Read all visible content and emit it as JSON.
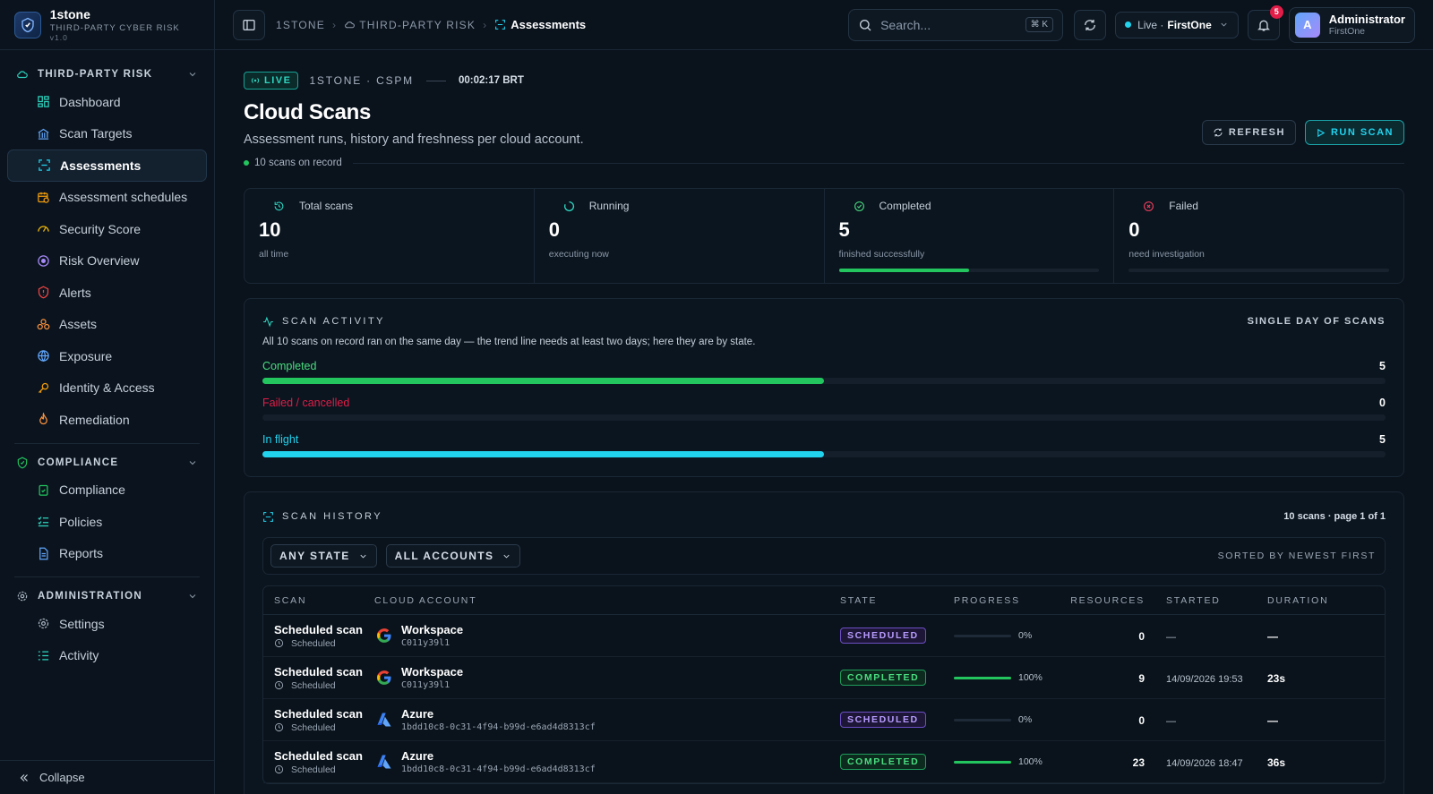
{
  "brand": {
    "name": "1stone",
    "subtitle": "THIRD-PARTY CYBER RISK",
    "version": "v1.0"
  },
  "sidebar": {
    "sections": [
      {
        "title": "THIRD-PARTY RISK",
        "items": [
          "Dashboard",
          "Scan Targets",
          "Assessments",
          "Assessment schedules",
          "Security Score",
          "Risk Overview",
          "Alerts",
          "Assets",
          "Exposure",
          "Identity & Access",
          "Remediation"
        ]
      },
      {
        "title": "COMPLIANCE",
        "items": [
          "Compliance",
          "Policies",
          "Reports"
        ]
      },
      {
        "title": "ADMINISTRATION",
        "items": [
          "Settings",
          "Activity"
        ]
      }
    ],
    "active": "Assessments",
    "collapse_label": "Collapse"
  },
  "topbar": {
    "breadcrumbs": [
      "1STONE",
      "THIRD-PARTY RISK",
      "Assessments"
    ],
    "search_placeholder": "Search...",
    "search_shortcut": "⌘ K",
    "env_status": "Live ·",
    "env_name": "FirstOne",
    "notifications": "5",
    "user": {
      "initial": "A",
      "name": "Administrator",
      "org": "FirstOne"
    }
  },
  "page": {
    "live_label": "LIVE",
    "meta": "1STONE · CSPM",
    "time": "00:02:17 BRT",
    "title": "Cloud Scans",
    "subtitle": "Assessment runs, history and freshness per cloud account.",
    "records": "10 scans on record",
    "refresh_label": "REFRESH",
    "run_label": "RUN SCAN"
  },
  "stats": [
    {
      "label": "Total scans",
      "value": "10",
      "sub": "all time",
      "bar": null,
      "color": "#2dd4bf"
    },
    {
      "label": "Running",
      "value": "0",
      "sub": "executing now",
      "bar": null,
      "color": "#2dd4bf"
    },
    {
      "label": "Completed",
      "value": "5",
      "sub": "finished successfully",
      "bar": 0.5,
      "color": "#4ade80"
    },
    {
      "label": "Failed",
      "value": "0",
      "sub": "need investigation",
      "bar": 0,
      "color": "#f43f5e"
    }
  ],
  "activity": {
    "title": "SCAN ACTIVITY",
    "right": "SINGLE DAY OF SCANS",
    "description": "All 10 scans on record ran on the same day — the trend line needs at least two days; here they are by state.",
    "total": 10,
    "rows": [
      {
        "label": "Completed",
        "value": 5,
        "color": "#4ade80",
        "bar": "#22c55e"
      },
      {
        "label": "Failed / cancelled",
        "value": 0,
        "color": "#e11d48",
        "bar": "#e11d48"
      },
      {
        "label": "In flight",
        "value": 5,
        "color": "#22d3ee",
        "bar": "#22d3ee"
      }
    ]
  },
  "history": {
    "title": "SCAN HISTORY",
    "meta": "10 scans · page 1 of 1",
    "filter_state": "ANY STATE",
    "filter_account": "ALL ACCOUNTS",
    "sorted": "SORTED BY NEWEST FIRST",
    "columns": [
      "SCAN",
      "CLOUD ACCOUNT",
      "STATE",
      "PROGRESS",
      "RESOURCES",
      "STARTED",
      "DURATION"
    ],
    "rows": [
      {
        "name": "Scheduled scan",
        "type": "Scheduled",
        "provider": "google",
        "account": "Workspace",
        "account_id": "C011y39l1",
        "state": "SCHEDULED",
        "progress": 0,
        "progress_label": "0%",
        "resources": "0",
        "started": "—",
        "duration": "—"
      },
      {
        "name": "Scheduled scan",
        "type": "Scheduled",
        "provider": "google",
        "account": "Workspace",
        "account_id": "C011y39l1",
        "state": "COMPLETED",
        "progress": 100,
        "progress_label": "100%",
        "resources": "9",
        "started": "14/09/2026 19:53",
        "duration": "23s"
      },
      {
        "name": "Scheduled scan",
        "type": "Scheduled",
        "provider": "azure",
        "account": "Azure",
        "account_id": "1bdd10c8-0c31-4f94-b99d-e6ad4d8313cf",
        "state": "SCHEDULED",
        "progress": 0,
        "progress_label": "0%",
        "resources": "0",
        "started": "—",
        "duration": "—"
      },
      {
        "name": "Scheduled scan",
        "type": "Scheduled",
        "provider": "azure",
        "account": "Azure",
        "account_id": "1bdd10c8-0c31-4f94-b99d-e6ad4d8313cf",
        "state": "COMPLETED",
        "progress": 100,
        "progress_label": "100%",
        "resources": "23",
        "started": "14/09/2026 18:47",
        "duration": "36s"
      }
    ]
  }
}
